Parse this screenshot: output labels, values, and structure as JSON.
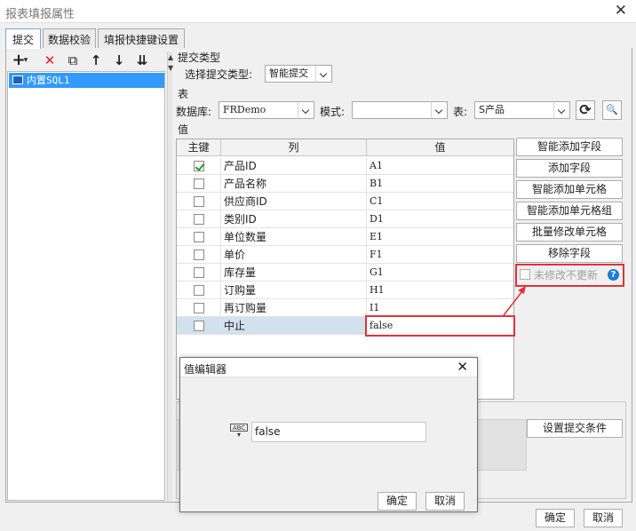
{
  "window": {
    "title": "报表填报属性",
    "close_glyph": "✕"
  },
  "tabs": [
    "提交",
    "数据校验",
    "填报快捷键设置"
  ],
  "toolbar": {
    "add": "+",
    "add_caret": "▾",
    "delete": "✕",
    "copy": "⧉",
    "up": "↑",
    "down": "↓",
    "sort": "⇊"
  },
  "tree": {
    "items": [
      "内置SQL1"
    ]
  },
  "submit_type": {
    "section_title": "提交类型",
    "label": "选择提交类型:",
    "value": "智能提交"
  },
  "table_section": {
    "title": "表",
    "db_label": "数据库:",
    "db_value": "FRDemo",
    "mode_label": "模式:",
    "mode_value": "",
    "table_label": "表:",
    "table_value": "S产品",
    "refresh_icon": "⟳",
    "preview_icon": "🔍"
  },
  "values_section": {
    "title": "值",
    "headers": [
      "主键",
      "列",
      "值"
    ],
    "rows": [
      {
        "key": true,
        "col": "产品ID",
        "val": "A1"
      },
      {
        "key": false,
        "col": "产品名称",
        "val": "B1"
      },
      {
        "key": false,
        "col": "供应商ID",
        "val": "C1"
      },
      {
        "key": false,
        "col": "类别ID",
        "val": "D1"
      },
      {
        "key": false,
        "col": "单位数量",
        "val": "E1"
      },
      {
        "key": false,
        "col": "单价",
        "val": "F1"
      },
      {
        "key": false,
        "col": "库存量",
        "val": "G1"
      },
      {
        "key": false,
        "col": "订购量",
        "val": "H1"
      },
      {
        "key": false,
        "col": "再订购量",
        "val": "I1"
      },
      {
        "key": false,
        "col": "中止",
        "val": "false"
      }
    ]
  },
  "side_buttons": [
    "智能添加字段",
    "添加字段",
    "智能添加单元格",
    "智能添加单元格组",
    "批量修改单元格",
    "移除字段"
  ],
  "unchanged_no_update": {
    "label": "未修改不更新",
    "help": "?"
  },
  "submit_condition_button": "设置提交条件",
  "footer": {
    "ok": "确定",
    "cancel": "取消"
  },
  "value_editor": {
    "title": "值编辑器",
    "close_glyph": "✕",
    "type_icon": "ABC",
    "value": "false",
    "ok": "确定",
    "cancel": "取消"
  },
  "colors": {
    "selection": "#3399ff",
    "highlight": "#e0323a",
    "row_selected": "#d2e1ee",
    "help": "#1d7bd6"
  }
}
